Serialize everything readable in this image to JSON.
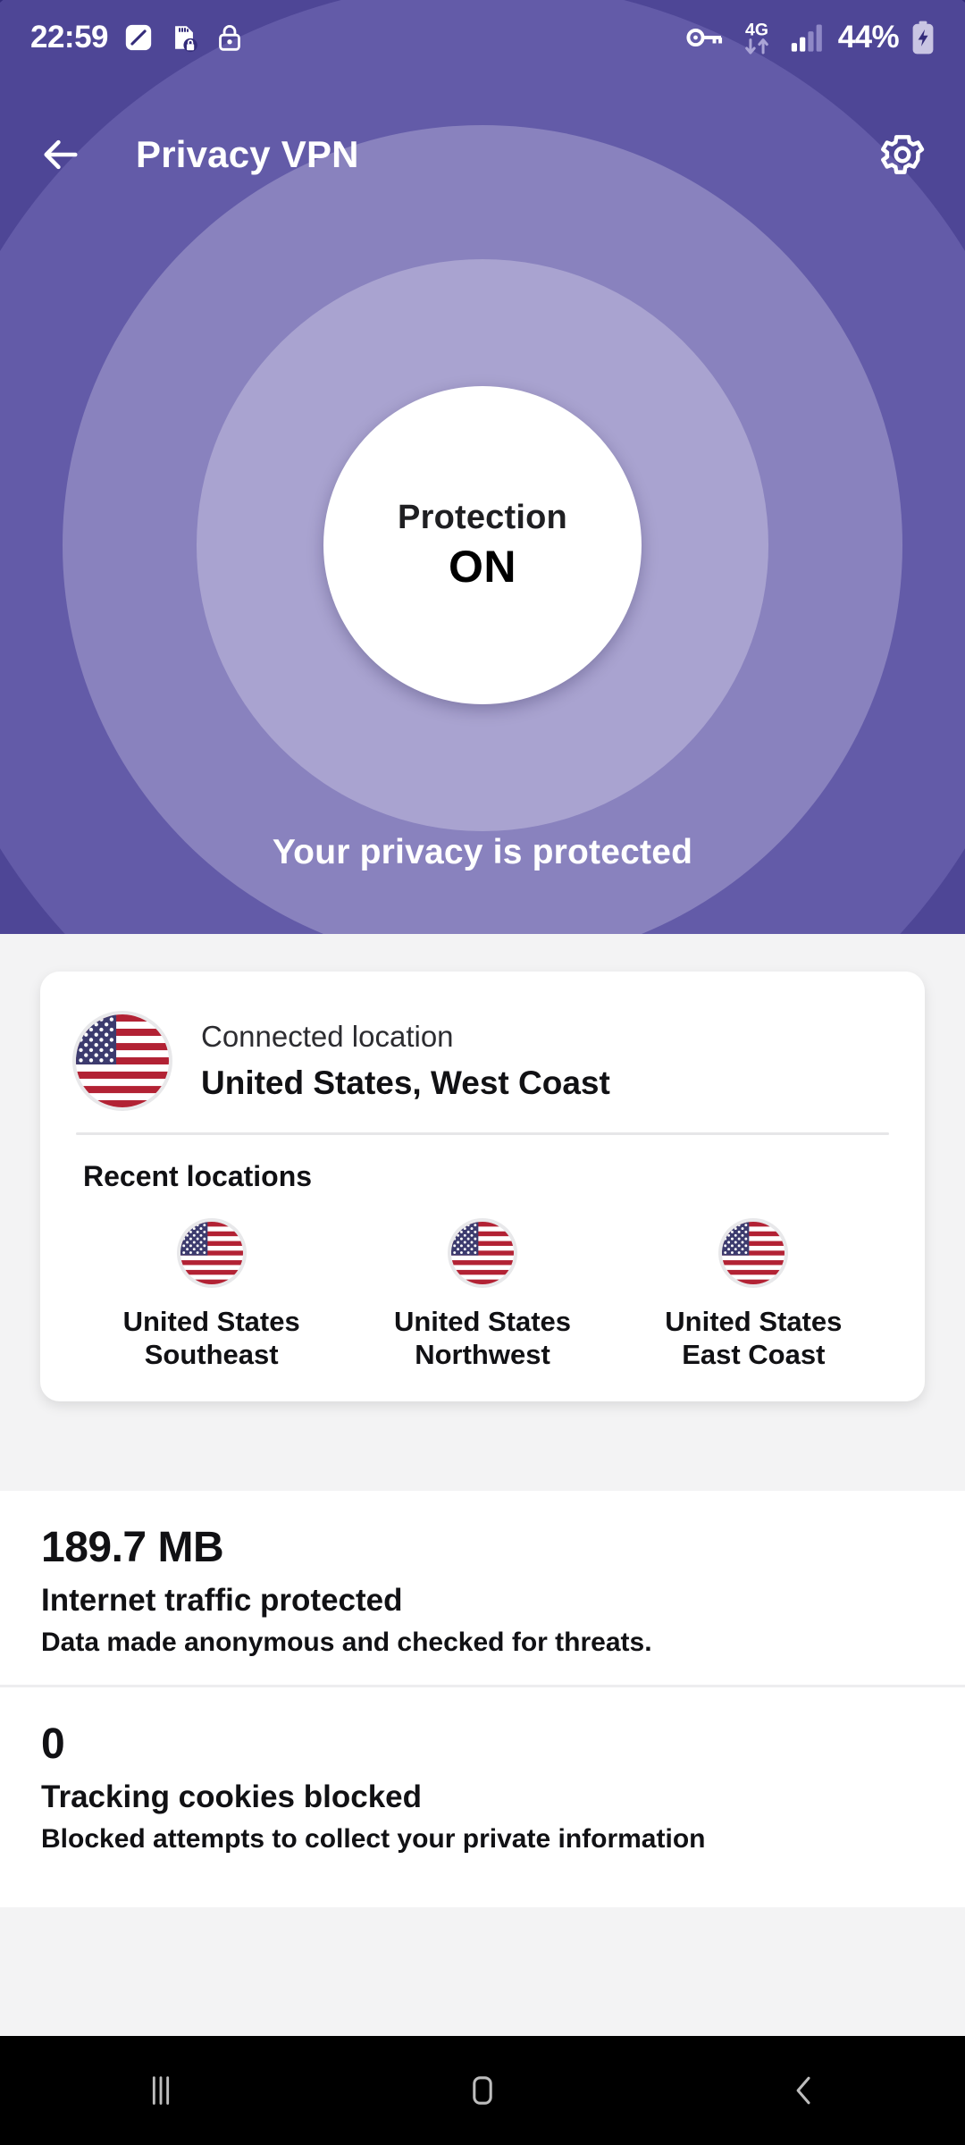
{
  "status_bar": {
    "clock": "22:59",
    "left_icons": [
      "do-not-disturb-icon",
      "sd-card-lock-icon",
      "lock-icon"
    ],
    "right_icons": [
      "vpn-key-icon",
      "signal-bars-icon",
      "battery-charging-icon"
    ],
    "network_type": "4G",
    "battery_percent": "44%"
  },
  "app_bar": {
    "back_icon": "arrow-left-icon",
    "title": "Privacy VPN",
    "settings_icon": "gear-icon"
  },
  "hero": {
    "power_label": "Protection",
    "power_state": "ON",
    "tagline": "Your privacy is protected",
    "colors": {
      "base": "#332B7A",
      "ring1": "#4E4696",
      "ring2": "#635BA8",
      "ring3": "#8982BE",
      "ring4": "#A9A3D0",
      "button": "#FFFFFF"
    }
  },
  "location_card": {
    "flag_icon": "us-flag-icon",
    "connected_caption": "Connected location",
    "connected_value": "United States, West Coast",
    "recent_title": "Recent locations",
    "recent": [
      {
        "flag_icon": "us-flag-icon",
        "label": "United States\nSoutheast"
      },
      {
        "flag_icon": "us-flag-icon",
        "label": "United States\nNorthwest"
      },
      {
        "flag_icon": "us-flag-icon",
        "label": "United States\nEast Coast"
      }
    ]
  },
  "stats": [
    {
      "value": "189.7 MB",
      "title": "Internet traffic protected",
      "description": "Data made anonymous and checked for threats."
    },
    {
      "value": "0",
      "title": "Tracking cookies blocked",
      "description": "Blocked attempts to collect your private information"
    }
  ],
  "nav_bar": {
    "recents_icon": "recents-icon",
    "home_icon": "home-icon",
    "back_icon": "back-chevron-icon"
  }
}
